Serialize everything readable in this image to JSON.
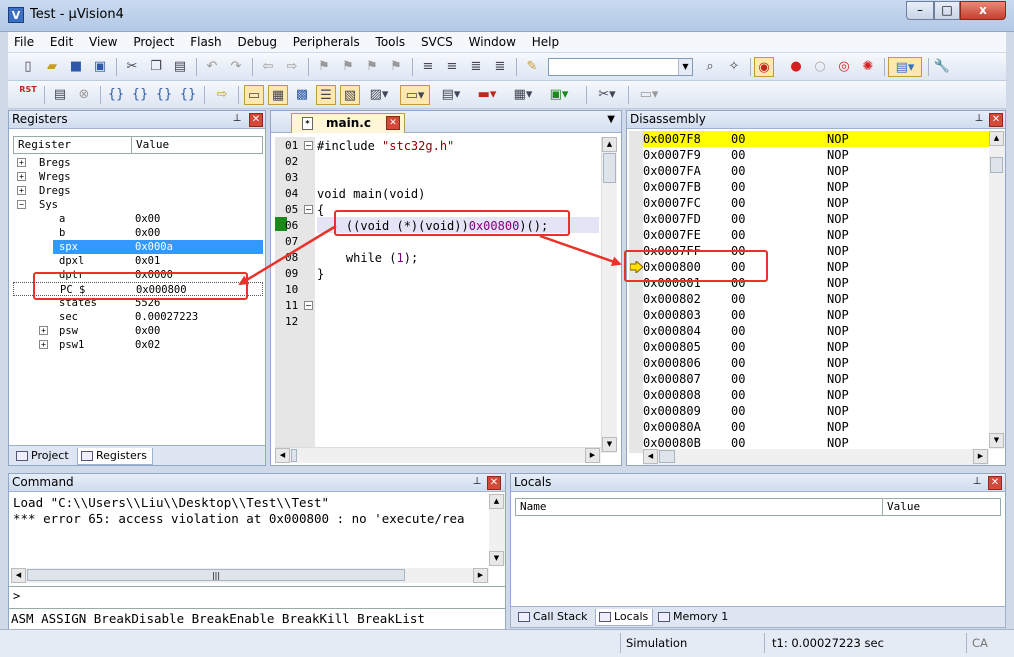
{
  "window": {
    "title": "Test - µVision4",
    "icon_letter": "V",
    "min": "–",
    "max": "□",
    "close": "x"
  },
  "menu": [
    "File",
    "Edit",
    "View",
    "Project",
    "Flash",
    "Debug",
    "Peripherals",
    "Tools",
    "SVCS",
    "Window",
    "Help"
  ],
  "toolbar": {
    "target_combo_value": "",
    "rst_label": "RST"
  },
  "registers": {
    "title": "Registers",
    "col_register": "Register",
    "col_value": "Value",
    "groups": [
      {
        "name": "Bregs",
        "expander": "+"
      },
      {
        "name": "Wregs",
        "expander": "+"
      },
      {
        "name": "Dregs",
        "expander": "+"
      },
      {
        "name": "Sys",
        "expander": "−"
      }
    ],
    "sys": [
      {
        "name": "a",
        "value": "0x00"
      },
      {
        "name": "b",
        "value": "0x00"
      },
      {
        "name": "spx",
        "value": "0x000a",
        "selected": true
      },
      {
        "name": "dpxl",
        "value": "0x01"
      },
      {
        "name": "dptr",
        "value": "0x0000"
      },
      {
        "name": "PC  $",
        "value": "0x000800"
      },
      {
        "name": "states",
        "value": "5526"
      },
      {
        "name": "sec",
        "value": "0.00027223"
      },
      {
        "name": "psw",
        "value": "0x00",
        "expander": "+"
      },
      {
        "name": "psw1",
        "value": "0x02",
        "expander": "+"
      }
    ],
    "tabs": [
      "Project",
      "Registers"
    ]
  },
  "editor": {
    "tab_label": "main.c",
    "lines": [
      {
        "num": "01",
        "text": "#include \"stc32g.h\""
      },
      {
        "num": "02",
        "text": ""
      },
      {
        "num": "03",
        "text": ""
      },
      {
        "num": "04",
        "text": "void main(void)"
      },
      {
        "num": "05",
        "text": "{"
      },
      {
        "num": "06",
        "text": "    ((void (*)(void))0x00800)();"
      },
      {
        "num": "07",
        "text": ""
      },
      {
        "num": "08",
        "text": "    while (1);"
      },
      {
        "num": "09",
        "text": "}"
      },
      {
        "num": "10",
        "text": ""
      },
      {
        "num": "11",
        "text": ""
      },
      {
        "num": "12",
        "text": ""
      }
    ],
    "line1_prefix": "#include ",
    "line1_str": "\"stc32g.h\"",
    "line6_prefix": "    ((void (*)(void))",
    "line6_num": "0x00800",
    "line6_suffix": ")();",
    "line8_prefix": "    while (",
    "line8_num": "1",
    "line8_suffix": ");"
  },
  "disassembly": {
    "title": "Disassembly",
    "rows": [
      {
        "addr": "0x0007F8",
        "op": "00",
        "mn": "NOP",
        "hl": true
      },
      {
        "addr": "0x0007F9",
        "op": "00",
        "mn": "NOP"
      },
      {
        "addr": "0x0007FA",
        "op": "00",
        "mn": "NOP"
      },
      {
        "addr": "0x0007FB",
        "op": "00",
        "mn": "NOP"
      },
      {
        "addr": "0x0007FC",
        "op": "00",
        "mn": "NOP"
      },
      {
        "addr": "0x0007FD",
        "op": "00",
        "mn": "NOP"
      },
      {
        "addr": "0x0007FE",
        "op": "00",
        "mn": "NOP"
      },
      {
        "addr": "0x0007FF",
        "op": "00",
        "mn": "NOP"
      },
      {
        "addr": "0x000800",
        "op": "00",
        "mn": "NOP",
        "current": true
      },
      {
        "addr": "0x000801",
        "op": "00",
        "mn": "NOP"
      },
      {
        "addr": "0x000802",
        "op": "00",
        "mn": "NOP"
      },
      {
        "addr": "0x000803",
        "op": "00",
        "mn": "NOP"
      },
      {
        "addr": "0x000804",
        "op": "00",
        "mn": "NOP"
      },
      {
        "addr": "0x000805",
        "op": "00",
        "mn": "NOP"
      },
      {
        "addr": "0x000806",
        "op": "00",
        "mn": "NOP"
      },
      {
        "addr": "0x000807",
        "op": "00",
        "mn": "NOP"
      },
      {
        "addr": "0x000808",
        "op": "00",
        "mn": "NOP"
      },
      {
        "addr": "0x000809",
        "op": "00",
        "mn": "NOP"
      },
      {
        "addr": "0x00080A",
        "op": "00",
        "mn": "NOP"
      },
      {
        "addr": "0x00080B",
        "op": "00",
        "mn": "NOP"
      }
    ]
  },
  "command": {
    "title": "Command",
    "output": [
      "Load \"C:\\\\Users\\\\Liu\\\\Desktop\\\\Test\\\\Test\"",
      "*** error 65: access violation at 0x000800 : no 'execute/rea"
    ],
    "prompt": ">",
    "input_value": "",
    "hints": "ASM ASSIGN BreakDisable BreakEnable BreakKill BreakList",
    "hscroll_grip": "|||"
  },
  "locals": {
    "title": "Locals",
    "col_name": "Name",
    "col_value": "Value",
    "tabs": [
      "Call Stack",
      "Locals",
      "Memory 1"
    ]
  },
  "status": {
    "mode": "Simulation",
    "time": "t1: 0.00027223 sec",
    "caps": "CA"
  },
  "colors": {
    "annotation_red": "#e8322a",
    "highlight_yellow": "#ffff00",
    "selection_blue": "#3399ff"
  }
}
